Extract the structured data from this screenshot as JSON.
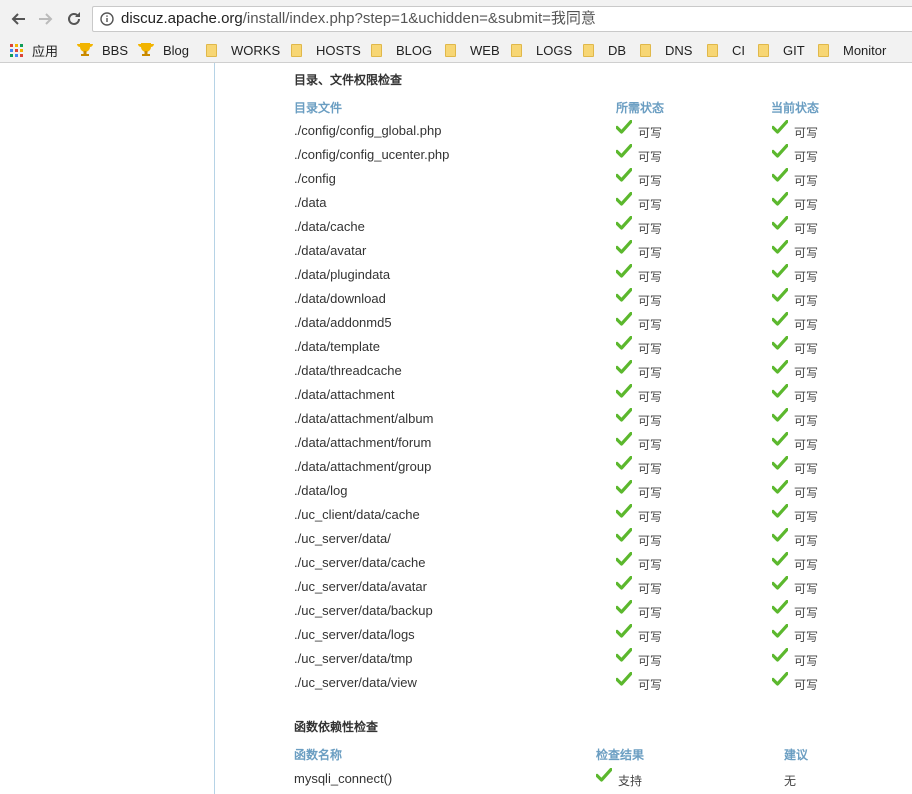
{
  "browser": {
    "url_host": "discuz.apache.org",
    "url_path": "/install/index.php?step=1&uchidden=&submit=我同意",
    "bookmarks": [
      {
        "label": "应用",
        "icon": "apps-grid-icon"
      },
      {
        "label": "BBS",
        "icon": "trophy-icon"
      },
      {
        "label": "Blog",
        "icon": "trophy-icon"
      },
      {
        "label": "WORKS",
        "icon": "folder-icon"
      },
      {
        "label": "HOSTS",
        "icon": "folder-icon"
      },
      {
        "label": "BLOG",
        "icon": "folder-icon"
      },
      {
        "label": "WEB",
        "icon": "folder-icon"
      },
      {
        "label": "LOGS",
        "icon": "folder-icon"
      },
      {
        "label": "DB",
        "icon": "folder-icon"
      },
      {
        "label": "DNS",
        "icon": "folder-icon"
      },
      {
        "label": "CI",
        "icon": "folder-icon"
      },
      {
        "label": "GIT",
        "icon": "folder-icon"
      },
      {
        "label": "Monitor",
        "icon": "folder-icon"
      }
    ]
  },
  "dir_check": {
    "title": "目录、文件权限检查",
    "col_file": "目录文件",
    "col_required": "所需状态",
    "col_current": "当前状态",
    "rows": [
      {
        "path": "./config/config_global.php",
        "required": "可写",
        "current": "可写"
      },
      {
        "path": "./config/config_ucenter.php",
        "required": "可写",
        "current": "可写"
      },
      {
        "path": "./config",
        "required": "可写",
        "current": "可写"
      },
      {
        "path": "./data",
        "required": "可写",
        "current": "可写"
      },
      {
        "path": "./data/cache",
        "required": "可写",
        "current": "可写"
      },
      {
        "path": "./data/avatar",
        "required": "可写",
        "current": "可写"
      },
      {
        "path": "./data/plugindata",
        "required": "可写",
        "current": "可写"
      },
      {
        "path": "./data/download",
        "required": "可写",
        "current": "可写"
      },
      {
        "path": "./data/addonmd5",
        "required": "可写",
        "current": "可写"
      },
      {
        "path": "./data/template",
        "required": "可写",
        "current": "可写"
      },
      {
        "path": "./data/threadcache",
        "required": "可写",
        "current": "可写"
      },
      {
        "path": "./data/attachment",
        "required": "可写",
        "current": "可写"
      },
      {
        "path": "./data/attachment/album",
        "required": "可写",
        "current": "可写"
      },
      {
        "path": "./data/attachment/forum",
        "required": "可写",
        "current": "可写"
      },
      {
        "path": "./data/attachment/group",
        "required": "可写",
        "current": "可写"
      },
      {
        "path": "./data/log",
        "required": "可写",
        "current": "可写"
      },
      {
        "path": "./uc_client/data/cache",
        "required": "可写",
        "current": "可写"
      },
      {
        "path": "./uc_server/data/",
        "required": "可写",
        "current": "可写"
      },
      {
        "path": "./uc_server/data/cache",
        "required": "可写",
        "current": "可写"
      },
      {
        "path": "./uc_server/data/avatar",
        "required": "可写",
        "current": "可写"
      },
      {
        "path": "./uc_server/data/backup",
        "required": "可写",
        "current": "可写"
      },
      {
        "path": "./uc_server/data/logs",
        "required": "可写",
        "current": "可写"
      },
      {
        "path": "./uc_server/data/tmp",
        "required": "可写",
        "current": "可写"
      },
      {
        "path": "./uc_server/data/view",
        "required": "可写",
        "current": "可写"
      }
    ]
  },
  "func_check": {
    "title": "函数依赖性检查",
    "col_name": "函数名称",
    "col_result": "检查结果",
    "col_advice": "建议",
    "rows": [
      {
        "name": "mysqli_connect()",
        "result": "支持",
        "advice": "无"
      }
    ]
  },
  "colors": {
    "check_green": "#5cb82e",
    "column_header": "#6b9ec2",
    "sidebar_border": "#b6d3e6"
  }
}
